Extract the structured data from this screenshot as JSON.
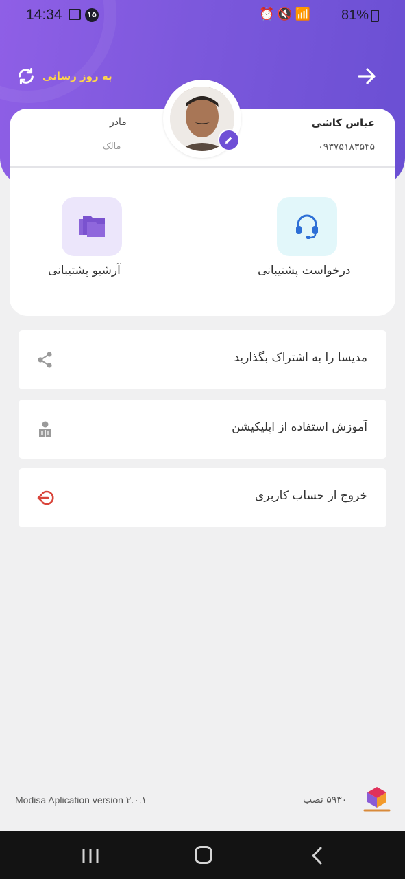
{
  "status_bar": {
    "time": "14:34",
    "notification_badge": "۱۵",
    "battery": "81%"
  },
  "header": {
    "refresh_label": "به روز رسانی",
    "colors": {
      "gradient_start": "#8f5fe6",
      "gradient_end": "#6a4fd3",
      "refresh_text": "#ffd54a"
    }
  },
  "profile": {
    "name": "عباس کاشی",
    "phone": "۰۹۳۷۵۱۸۳۵۴۵",
    "relation": "مادر",
    "role": "مالک"
  },
  "quick_actions": [
    {
      "label": "درخواست پشتیبانی",
      "icon": "headset-icon"
    },
    {
      "label": "آرشیو پشتیبانی",
      "icon": "folders-icon"
    }
  ],
  "menu": [
    {
      "label": "مدیسا را به اشتراک بگذارید",
      "icon": "share-icon"
    },
    {
      "label": "آموزش استفاده از اپلیکیشن",
      "icon": "reading-person-icon"
    },
    {
      "label": "خروج از حساب کاربری",
      "icon": "logout-icon"
    }
  ],
  "footer": {
    "app_version": "Modisa Aplication  version ۲.۰.۱",
    "installs": "۵۹۳۰ نصب"
  }
}
